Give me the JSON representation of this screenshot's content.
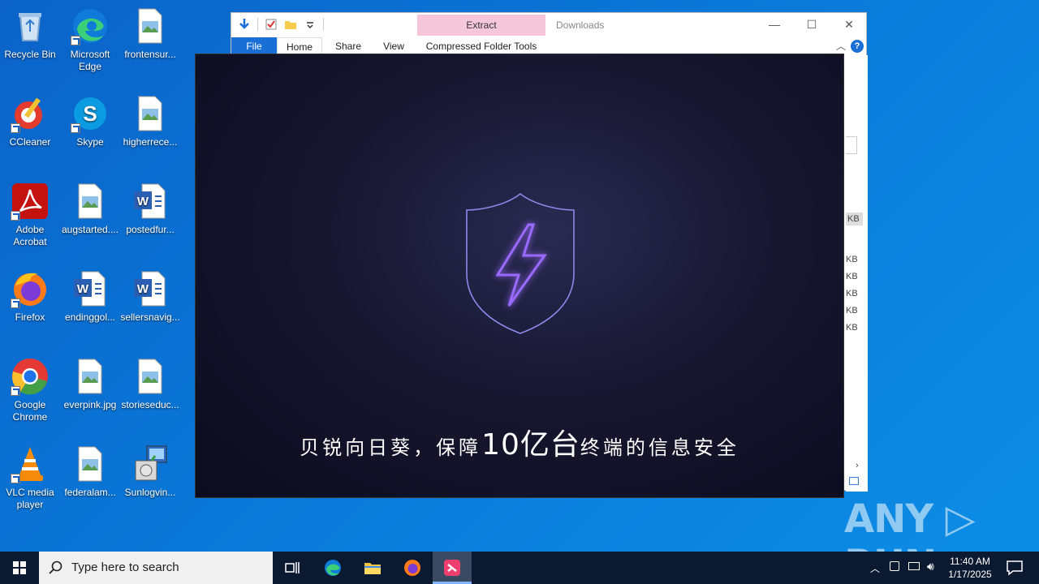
{
  "desktop": {
    "icons": [
      {
        "label": "Recycle Bin"
      },
      {
        "label": "Microsoft Edge"
      },
      {
        "label": "frontensur..."
      },
      {
        "label": "CCleaner"
      },
      {
        "label": "Skype"
      },
      {
        "label": "higherrece..."
      },
      {
        "label": "Adobe Acrobat"
      },
      {
        "label": "augstarted...."
      },
      {
        "label": "postedfur..."
      },
      {
        "label": "Firefox"
      },
      {
        "label": "endinggol..."
      },
      {
        "label": "sellersnavig..."
      },
      {
        "label": "Google Chrome"
      },
      {
        "label": "everpink.jpg"
      },
      {
        "label": "storieseduc..."
      },
      {
        "label": "VLC media player"
      },
      {
        "label": "federalam..."
      },
      {
        "label": "Sunlogvin..."
      }
    ]
  },
  "explorer": {
    "context_tab": "Extract",
    "title": "Downloads",
    "context_group": "Compressed Folder Tools",
    "tabs": [
      "File",
      "Home",
      "Share",
      "View"
    ],
    "size_labels": [
      "KB",
      "KB",
      "KB",
      "KB",
      "KB",
      "KB"
    ],
    "help": "?"
  },
  "splash": {
    "caption_pre": "贝锐向日葵，保障",
    "caption_big": "10亿台",
    "caption_post": "终端的信息安全"
  },
  "watermark": "ANY ▷ RUN",
  "taskbar": {
    "search_placeholder": "Type here to search",
    "time": "11:40 AM",
    "date": "1/17/2025"
  },
  "colors": {
    "desktop": "#0a78d8",
    "taskbar": "#0b1a30",
    "context_tab": "#f6c7d9",
    "file_tab": "#1a6fd6",
    "shield_glow": "#7b4dff"
  }
}
